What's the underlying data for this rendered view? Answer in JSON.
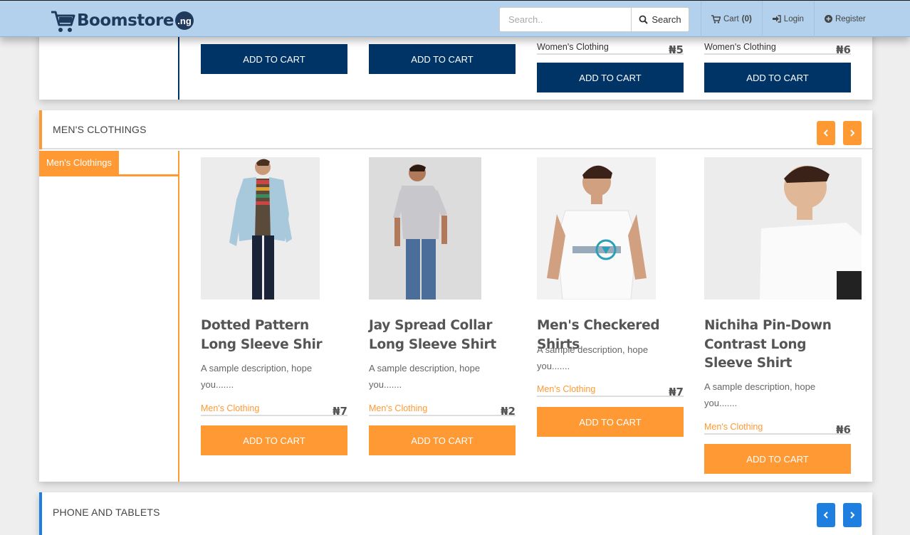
{
  "navbar": {
    "logo_text": "Boomstore",
    "logo_badge": ".ng",
    "search_placeholder": "Search..",
    "search_button": "Search",
    "cart_label": "Cart",
    "cart_count": "(0)",
    "login_label": "Login",
    "register_label": "Register"
  },
  "top_section": {
    "buttons": [
      "ADD TO CART",
      "ADD TO CART",
      "ADD TO CART",
      "ADD TO CART"
    ],
    "items": [
      {
        "category": "Women's Clothing",
        "price": "₦5"
      },
      {
        "category": "Women's Clothing",
        "price": "₦6"
      }
    ]
  },
  "mens": {
    "title": "MEN'S CLOTHINGS",
    "sidebar_tab": "Men's Clothings",
    "prev_icon": "chevron-left-icon",
    "next_icon": "chevron-right-icon",
    "products": [
      {
        "title": "Dotted Pattern Long Sleeve Shir",
        "description": "A sample description, hope you.......",
        "category": "Men's Clothing",
        "price": "₦7",
        "button": "ADD TO CART"
      },
      {
        "title": "Jay Spread Collar Long Sleeve Shirt",
        "description": "A sample description, hope you.......",
        "category": "Men's Clothing",
        "price": "₦2",
        "button": "ADD TO CART"
      },
      {
        "title": "Men's Checkered Shirts",
        "description": "A sample description, hope you.......",
        "category": "Men's Clothing",
        "price": "₦7",
        "button": "ADD TO CART"
      },
      {
        "title": "Nichiha Pin-Down Contrast Long Sleeve Shirt",
        "description": "A sample description, hope you.......",
        "category": "Men's Clothing",
        "price": "₦6",
        "button": "ADD TO CART"
      }
    ]
  },
  "phones": {
    "title": "PHONE AND TABLETS"
  },
  "colors": {
    "navbar": "#b3d1ec",
    "navy": "#003366",
    "orange": "#ff9933",
    "blue": "#1e7fe0"
  }
}
